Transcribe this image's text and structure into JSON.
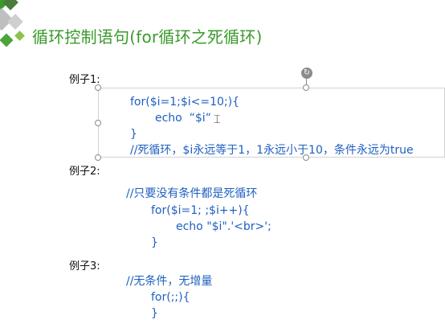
{
  "slide": {
    "title": "循环控制语句(for循环之死循环)",
    "accent_color": "#3a9a2c",
    "code_color": "#1f5fc1"
  },
  "example1": {
    "label": "例子1:",
    "lines": [
      "for($i=1;$i<=10;){",
      "echo  “$i“",
      "}",
      "//死循环，$i永远等于1，1永远小于10，条件永远为true"
    ]
  },
  "example2": {
    "label": "例子2:",
    "lines": [
      "//只要没有条件都是死循环",
      "for($i=1; ;$i++){",
      "echo \"$i\".'<br>';",
      "}"
    ]
  },
  "example3": {
    "label": "例子3:",
    "lines": [
      "//无条件，无增量",
      "for(;;){",
      "}"
    ]
  },
  "selection": {
    "rotate_icon": "rotate-handle-icon",
    "cursor_icon": "text-cursor-icon"
  }
}
